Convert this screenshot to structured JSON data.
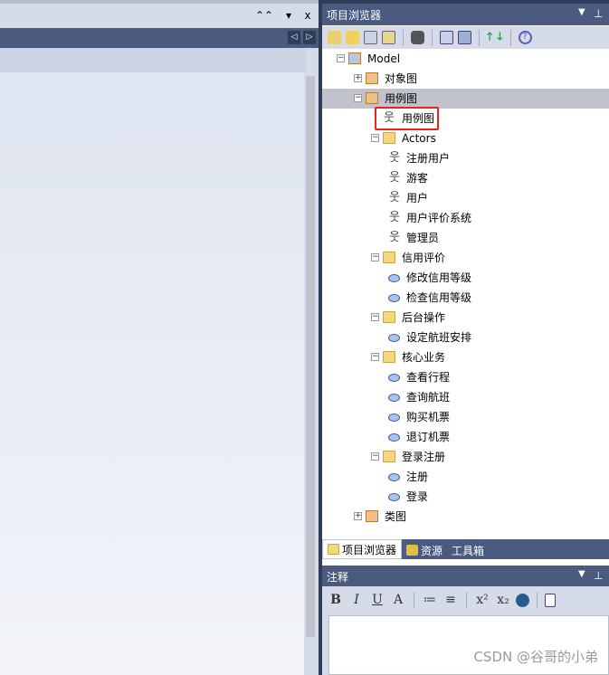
{
  "left_panel": {
    "controls": [
      "⌃⌃",
      "▾",
      "x"
    ],
    "nav": [
      "◁",
      "▷"
    ]
  },
  "browser": {
    "title": "项目浏览器",
    "tree": [
      {
        "label": "Model",
        "level": 0,
        "toggle": "−",
        "icon": "model-icon"
      },
      {
        "label": "对象图",
        "level": 1,
        "toggle": "+",
        "icon": "package-icon"
      },
      {
        "label": "用例图",
        "level": 1,
        "toggle": "−",
        "icon": "package-icon",
        "selected": true
      },
      {
        "label": "用例图",
        "level": 2,
        "icon": "usecase-diagram-icon",
        "highlighted": true
      },
      {
        "label": "Actors",
        "level": 2,
        "toggle": "−",
        "icon": "folder-icon"
      },
      {
        "label": "注册用户",
        "level": 3,
        "icon": "actor-icon"
      },
      {
        "label": "游客",
        "level": 3,
        "icon": "actor-icon"
      },
      {
        "label": "用户",
        "level": 3,
        "icon": "actor-icon"
      },
      {
        "label": "用户评价系统",
        "level": 3,
        "icon": "actor-icon"
      },
      {
        "label": "管理员",
        "level": 3,
        "icon": "actor-icon"
      },
      {
        "label": "信用评价",
        "level": 2,
        "toggle": "−",
        "icon": "folder-icon"
      },
      {
        "label": "修改信用等级",
        "level": 3,
        "icon": "usecase-icon"
      },
      {
        "label": "检查信用等级",
        "level": 3,
        "icon": "usecase-icon"
      },
      {
        "label": "后台操作",
        "level": 2,
        "toggle": "−",
        "icon": "folder-icon"
      },
      {
        "label": "设定航班安排",
        "level": 3,
        "icon": "usecase-icon"
      },
      {
        "label": "核心业务",
        "level": 2,
        "toggle": "−",
        "icon": "folder-icon"
      },
      {
        "label": "查看行程",
        "level": 3,
        "icon": "usecase-icon"
      },
      {
        "label": "查询航班",
        "level": 3,
        "icon": "usecase-icon"
      },
      {
        "label": "购买机票",
        "level": 3,
        "icon": "usecase-icon"
      },
      {
        "label": "退订机票",
        "level": 3,
        "icon": "usecase-icon"
      },
      {
        "label": "登录注册",
        "level": 2,
        "toggle": "−",
        "icon": "folder-icon"
      },
      {
        "label": "注册",
        "level": 3,
        "icon": "usecase-icon"
      },
      {
        "label": "登录",
        "level": 3,
        "icon": "usecase-icon"
      },
      {
        "label": "类图",
        "level": 1,
        "toggle": "+",
        "icon": "class-package-icon"
      }
    ],
    "tabs": [
      {
        "label": "项目浏览器",
        "active": true
      },
      {
        "label": "资源"
      },
      {
        "label": "工具箱"
      }
    ]
  },
  "notes": {
    "title": "注释",
    "format": [
      "B",
      "I",
      "U",
      "A",
      "≔",
      "≡",
      "x²",
      "x₂"
    ]
  },
  "watermark": "CSDN @谷哥的小弟"
}
